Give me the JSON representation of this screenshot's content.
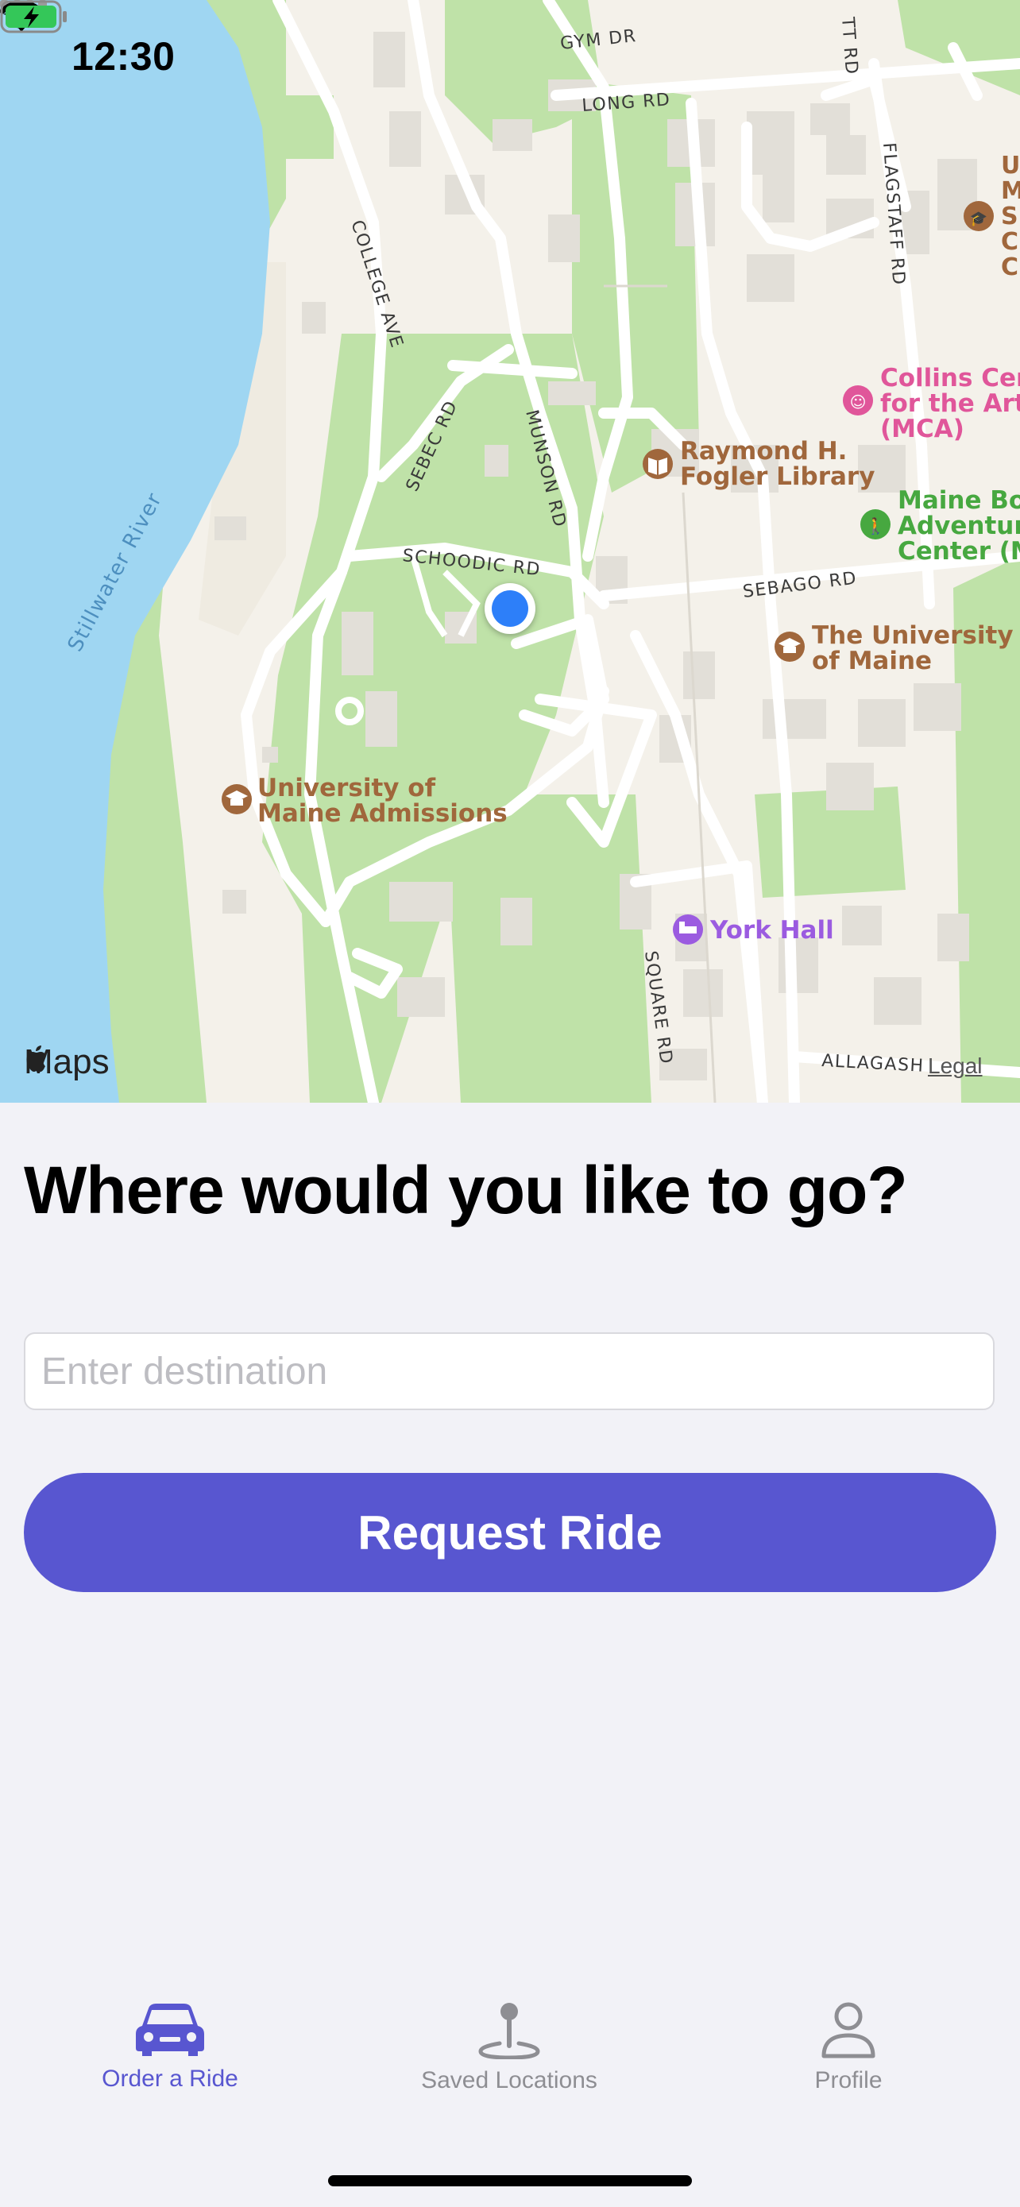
{
  "status_bar": {
    "time": "12:30"
  },
  "map": {
    "attribution": "Maps",
    "legal_label": "Legal",
    "river_label": "Stillwater River",
    "street_labels": {
      "gym_dr": "GYM DR",
      "long_rd": "LONG RD",
      "college_ave": "COLLEGE AVE",
      "flagstaff_rd": "FLAGSTAFF RD",
      "sebec_rd": "SEBEC RD",
      "munson_rd": "MUNSON RD",
      "schoodic_rd": "SCHOODIC RD",
      "sebago_rd": "SEBAGO RD",
      "square_rd": "SQUARE RD",
      "allagash": "ALLAGASH",
      "tt_rd": "TT RD"
    },
    "pois": {
      "collins_center": [
        "Collins Cent",
        "for the Arts",
        "(MCA)"
      ],
      "fogler_library": [
        "Raymond H.",
        "Fogler Library"
      ],
      "maine_bound": [
        "Maine Bou",
        "Adventure",
        "Center (M"
      ],
      "university_of_maine": [
        "The University",
        "of Maine"
      ],
      "admissions": [
        "University of",
        "Maine Admissions"
      ],
      "york_hall": [
        "York Hall"
      ],
      "top_right_partial": [
        "U",
        "M",
        "S",
        "C",
        "C"
      ]
    }
  },
  "main": {
    "headline": "Where would you like to go?",
    "destination_placeholder": "Enter destination",
    "request_button": "Request Ride"
  },
  "tab_bar": {
    "tabs": [
      {
        "label": "Order a Ride",
        "icon": "car-icon",
        "active": true
      },
      {
        "label": "Saved Locations",
        "icon": "map-pin-icon",
        "active": false
      },
      {
        "label": "Profile",
        "icon": "person-icon",
        "active": false
      }
    ]
  },
  "colors": {
    "accent": "#5856D0",
    "inactive_tab": "#8E8E93",
    "water": "#9FD6F2",
    "park": "#BFE2A8",
    "land": "#F4F1EA",
    "user_location": "#2D7FF9",
    "poi_brown": "#A0673C",
    "poi_pink": "#E0569A",
    "poi_green": "#47A840",
    "poi_purple": "#9B5BE0"
  }
}
